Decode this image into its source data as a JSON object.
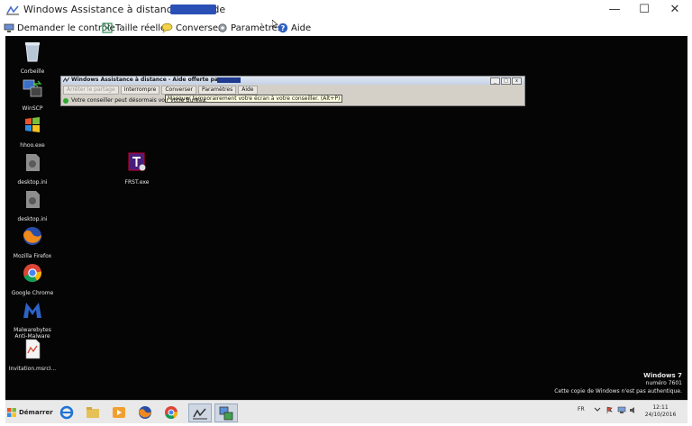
{
  "window": {
    "title": "Windows Assistance à distance - Aide de",
    "minimize": "—",
    "maximize": "☐",
    "close": "✕"
  },
  "toolbar": {
    "items": [
      {
        "label": "Demander le contrôle",
        "icon": "request-control-icon"
      },
      {
        "label": "Taille réelle",
        "icon": "actual-size-icon"
      },
      {
        "label": "Converser",
        "icon": "chat-icon"
      },
      {
        "label": "Paramètres",
        "icon": "settings-icon"
      },
      {
        "label": "Aide",
        "icon": "help-icon"
      }
    ]
  },
  "desktop": {
    "icons": [
      {
        "label": "Corbeille",
        "icon": "recycle-bin-icon"
      },
      {
        "label": "WinSCP",
        "icon": "winscp-icon"
      },
      {
        "label": "hhoo.exe",
        "icon": "windows-flag-icon"
      },
      {
        "label": "desktop.ini",
        "icon": "settings-file-icon"
      },
      {
        "label": "desktop.ini",
        "icon": "settings-file-icon"
      },
      {
        "label": "Mozilla Firefox",
        "icon": "firefox-icon"
      },
      {
        "label": "Google Chrome",
        "icon": "chrome-icon"
      },
      {
        "label": "Malwarebytes Anti-Malware",
        "icon": "malwarebytes-icon"
      },
      {
        "label": "Invitation.msrcI...",
        "icon": "invitation-file-icon"
      },
      {
        "label": "FRST.exe",
        "icon": "frst-icon"
      }
    ]
  },
  "remote_window": {
    "title": "Windows Assistance à distance - Aide offerte par",
    "tools": [
      {
        "label": "Arrêter le partage",
        "disabled": true
      },
      {
        "label": "Interrompre"
      },
      {
        "label": "Converser"
      },
      {
        "label": "Paramètres"
      },
      {
        "label": "Aide"
      }
    ],
    "tooltip": "Masquer temporairement votre écran à votre conseiller. (Alt+P)",
    "status": "Votre conseiller peut désormais voir votre Bureau."
  },
  "watermark": {
    "line1": "Windows 7",
    "line2": "numéro 7601",
    "line3": "Cette copie de Windows n'est pas authentique."
  },
  "taskbar": {
    "start_label": "Démarrer",
    "apps": [
      "internet-explorer-icon",
      "explorer-icon",
      "media-player-icon",
      "firefox-icon",
      "chrome-icon",
      "remote-assistance-icon",
      "remote-control-icon"
    ],
    "lang": "FR",
    "time": "12:11",
    "date": "24/10/2016"
  }
}
